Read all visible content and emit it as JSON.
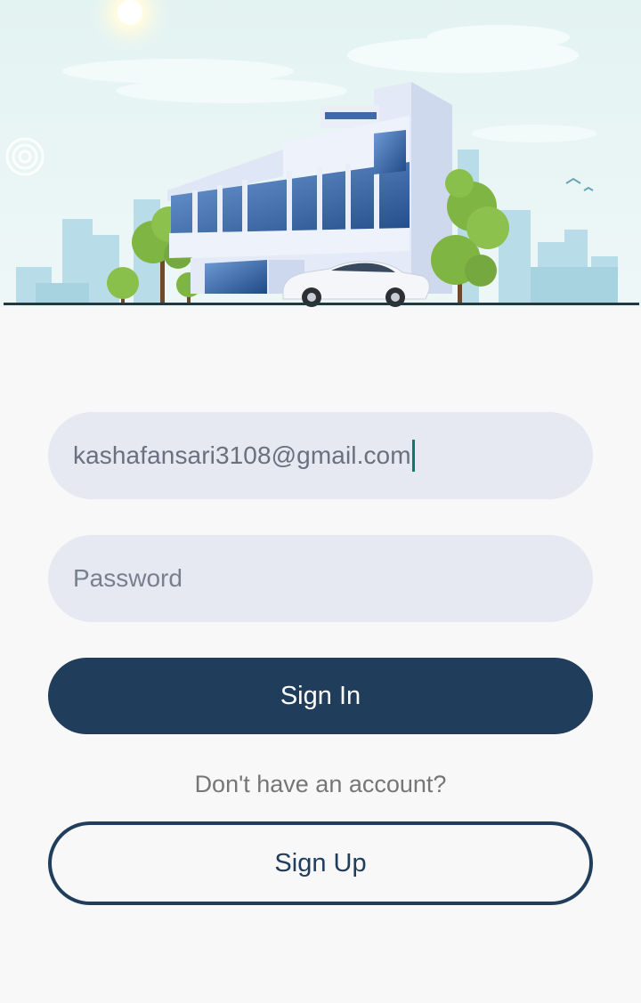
{
  "hero": {
    "image_description_icon": "office-building-illustration-icon"
  },
  "login": {
    "email_value": "kashafansari3108@gmail.com",
    "password_placeholder": "Password",
    "sign_in_label": "Sign In",
    "no_account_text": "Don't have an account?",
    "sign_up_label": "Sign Up"
  },
  "colors": {
    "primary": "#203d5c",
    "field_background": "#e6e8f2",
    "caret": "#0b7a6c",
    "page_background": "#f8f8f8"
  }
}
